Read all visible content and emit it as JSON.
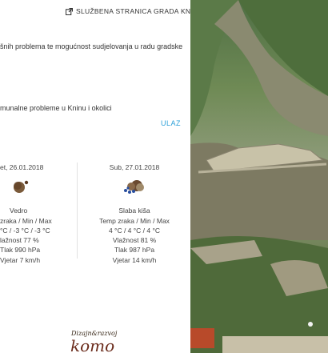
{
  "header": {
    "official_link": "SLUŽBENA STRANICA GRADA KNINA",
    "link_icon": "external-link-icon"
  },
  "intro": {
    "text1": "šnih problema te mogućnost sudjelovanja u radu gradske",
    "text2": "munalne probleme u Kninu i okolici",
    "enter_button": "ULAZ"
  },
  "weather": {
    "day1": {
      "date": "et, 26.01.2018",
      "condition": "Vedro",
      "temp_label": "zraka / Min / Max",
      "temps": "°C / -3 °C / -3 °C",
      "humidity": "lažnost 77 %",
      "pressure": "Tlak 990 hPa",
      "wind": "Vjetar 7 km/h",
      "icon": "clear-night-icon"
    },
    "day2": {
      "date": "Sub, 27.01.2018",
      "condition": "Slaba kiša",
      "temp_label": "Temp zraka / Min / Max",
      "temps": "4 °C / 4 °C / 4 °C",
      "humidity": "Vlažnost 81 %",
      "pressure": "Tlak 987 hPa",
      "wind": "Vjetar 14 km/h",
      "icon": "light-rain-icon"
    }
  },
  "footer": {
    "logo_small": "Dizajn&razvoj",
    "logo_big": "komo"
  },
  "colors": {
    "link": "#2a9fd8"
  }
}
